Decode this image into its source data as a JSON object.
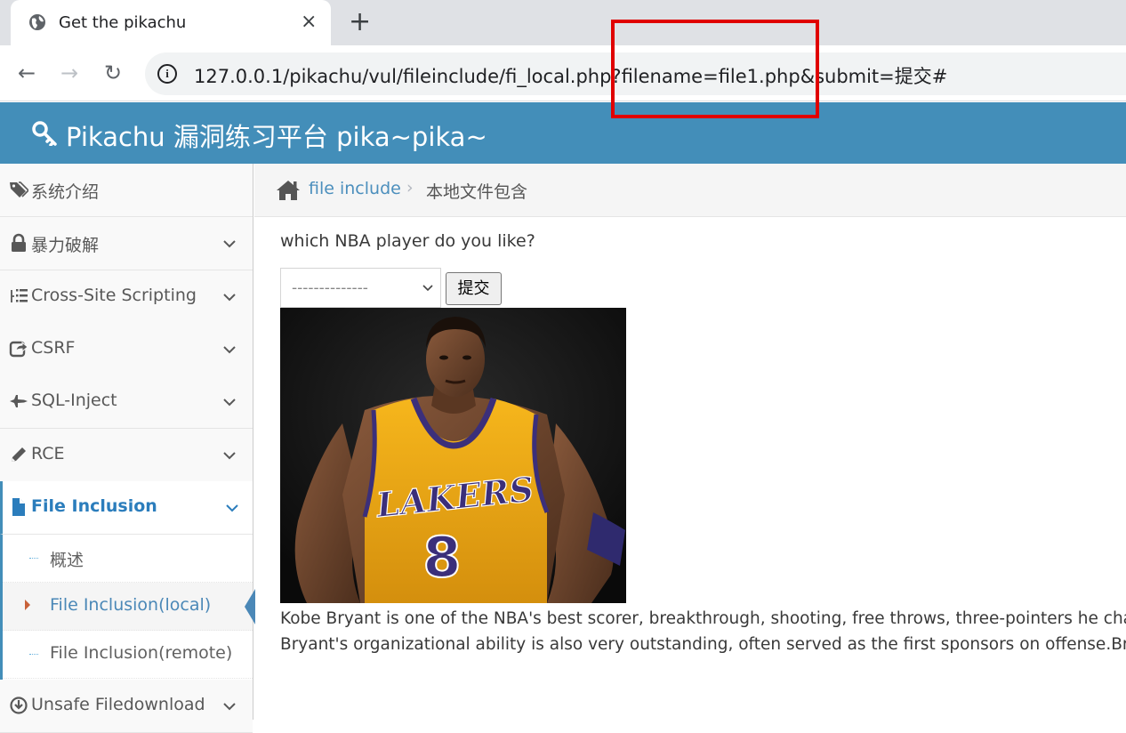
{
  "browser": {
    "tab_title": "Get the pikachu",
    "tab_close": "×",
    "new_tab": "+",
    "back": "←",
    "forward": "→",
    "reload": "↻",
    "info": "i",
    "url": "127.0.0.1/pikachu/vul/fileinclude/fi_local.php?filename=file1.php&submit=提交#"
  },
  "header": {
    "brand": "Pikachu 漏洞练习平台 pika~pika~"
  },
  "sidebar": {
    "items": [
      {
        "label": "系统介绍",
        "icon": "tags-icon"
      },
      {
        "label": "暴力破解",
        "icon": "lock-icon"
      },
      {
        "label": "Cross-Site Scripting",
        "icon": "list-icon"
      },
      {
        "label": "CSRF",
        "icon": "share-icon"
      },
      {
        "label": "SQL-Inject",
        "icon": "fighter-jet-icon"
      },
      {
        "label": "RCE",
        "icon": "pencil-icon"
      },
      {
        "label": "File Inclusion",
        "icon": "file-icon"
      },
      {
        "label": "Unsafe Filedownload",
        "icon": "download-icon"
      }
    ],
    "submenu": [
      {
        "label": "概述"
      },
      {
        "label": "File Inclusion(local)"
      },
      {
        "label": "File Inclusion(remote)"
      }
    ]
  },
  "breadcrumbs": {
    "link": "file include",
    "separator": "›",
    "current": "本地文件包含"
  },
  "main": {
    "question": "which NBA player do you like?",
    "select_value": "--------------",
    "submit_label": "提交",
    "photo_alt": "",
    "description_line1": "Kobe Bryant is one of the NBA's best scorer, breakthrough, shooting, free throws, three-pointers he champion",
    "description_line2": "Bryant's organizational ability is also very outstanding, often served as the first sponsors on offense.Bryant"
  },
  "colors": {
    "header_bg": "#438eb9",
    "highlight_box": "#e00000",
    "active_link": "#2b7dbc"
  }
}
